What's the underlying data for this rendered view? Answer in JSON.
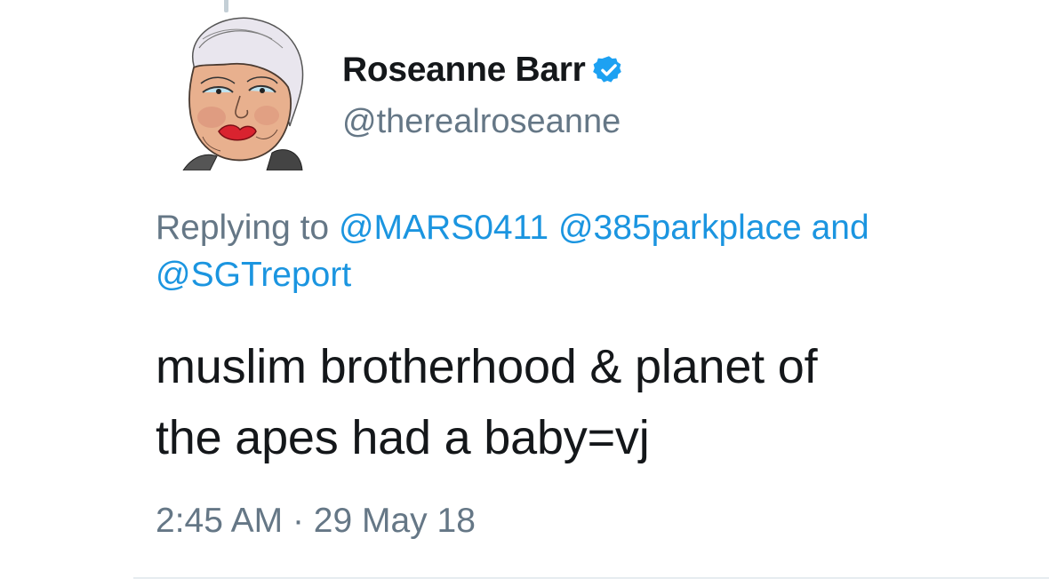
{
  "user": {
    "display_name": "Roseanne Barr",
    "handle": "@therealroseanne",
    "verified_icon": "verified-badge-icon",
    "avatar_icon": "avatar-illustration"
  },
  "reply": {
    "prefix": "Replying to",
    "mentions": [
      "@MARS0411",
      "@385parkplace",
      "@SGTreport"
    ],
    "conjunction": "and"
  },
  "tweet": {
    "text_line1": "muslim brotherhood & planet of",
    "text_line2": "the apes had a baby=vj"
  },
  "meta": {
    "time": "2:45 AM",
    "separator": "·",
    "date": "29 May 18"
  },
  "colors": {
    "link": "#1b95e0",
    "muted": "#657786",
    "text": "#14171a",
    "verified": "#1da1f2"
  }
}
